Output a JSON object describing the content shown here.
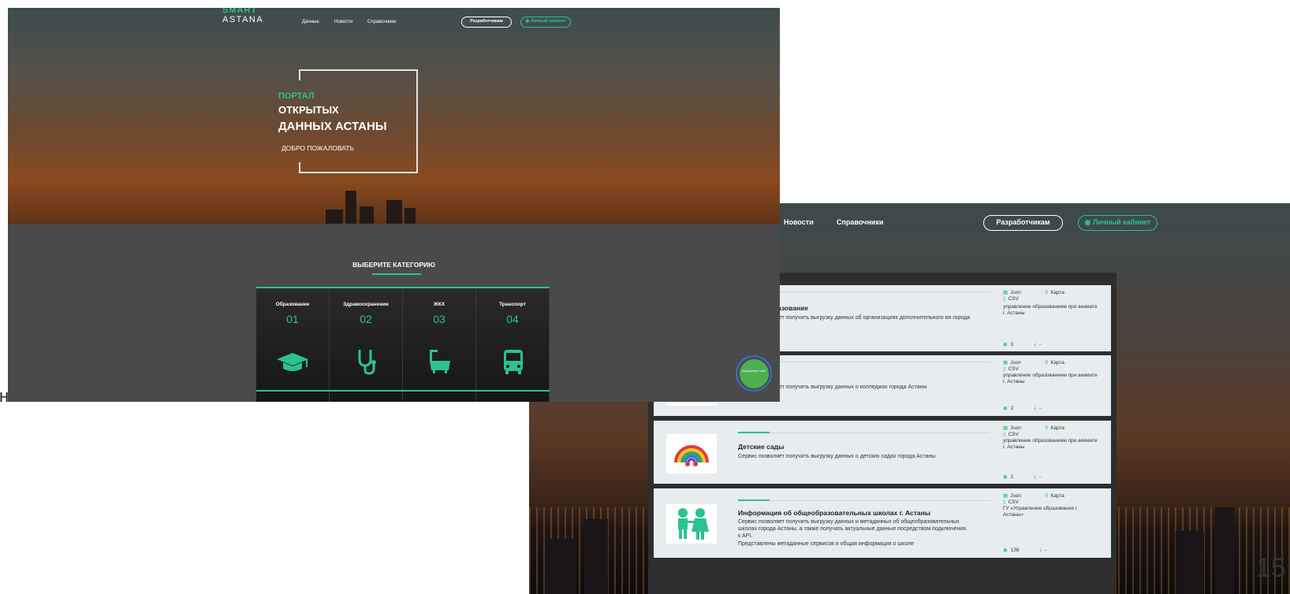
{
  "screen2": {
    "nav": {
      "news": "Новости",
      "references": "Справочники",
      "developers": "Разработчикам",
      "cabinet": "Личный кабинет"
    },
    "datasets": [
      {
        "title": "ное образование",
        "description": "ет позволяет получить выгрузку данных об организациях дополнительного ия города Астаны",
        "formats": [
          "Json",
          "Карта",
          "CSV"
        ],
        "owner": "управление образованием при акимате г. Астаны",
        "views": "3",
        "downloads": "-"
      },
      {
        "title": "",
        "description": "Сервис позволяет получить выгрузку данных о колледжах города Астаны",
        "formats": [
          "Json",
          "Карта",
          "CSV"
        ],
        "owner": "управление образованием при акимате г. Астаны",
        "views": "2",
        "downloads": "-"
      },
      {
        "title": "Детские сады",
        "description": "Сервис позволяет получить выгрузку данных о детских садах города Астаны",
        "formats": [
          "Json",
          "Карта",
          "CSV"
        ],
        "owner": "управление образованием при акимате г. Астаны",
        "views": "2",
        "downloads": "-"
      },
      {
        "title": "Информация об общеобразовательных школах г. Астаны",
        "description": "Сервис позволяет получить выгрузку данных и метаданных об общеобразовательных школах города Астаны, а также получать актуальные данные посредством подключения к API.",
        "extra": "Представлены метаданные сервисов и общая информация о школе",
        "formats": [
          "Json",
          "Карта",
          "CSV"
        ],
        "owner": "ГУ «Управление образования г. Астаны»",
        "views": "138",
        "downloads": "-"
      }
    ]
  },
  "screen1": {
    "logo": {
      "line1": "SMART",
      "line2": "ASTANA"
    },
    "nav": {
      "data": "Данные",
      "news": "Новости",
      "references": "Справочники",
      "developers": "Разработчикам",
      "cabinet": "Личный кабинет"
    },
    "hero": {
      "line1": "ПОРТАЛ",
      "line2": "ОТКРЫТЫХ",
      "line3": "ДАННЫХ АСТАНЫ",
      "welcome": "ДОБРО ПОЖАЛОВАТЬ"
    },
    "categories_title": "ВЫБЕРИТЕ КАТЕГОРИЮ",
    "categories": [
      {
        "name": "Образование",
        "number": "01",
        "icon": "graduation-cap-icon"
      },
      {
        "name": "Здравоохранение",
        "number": "02",
        "icon": "stethoscope-icon"
      },
      {
        "name": "ЖКХ",
        "number": "03",
        "icon": "bathtub-icon"
      },
      {
        "name": "Транспорт",
        "number": "04",
        "icon": "bus-icon"
      }
    ],
    "help_button": "Нарушение сайт"
  },
  "stray_text": "н",
  "page_number": "15",
  "colors": {
    "accent": "#2bc28f",
    "panel": "#2e2e2e",
    "card": "#e8ecee"
  }
}
